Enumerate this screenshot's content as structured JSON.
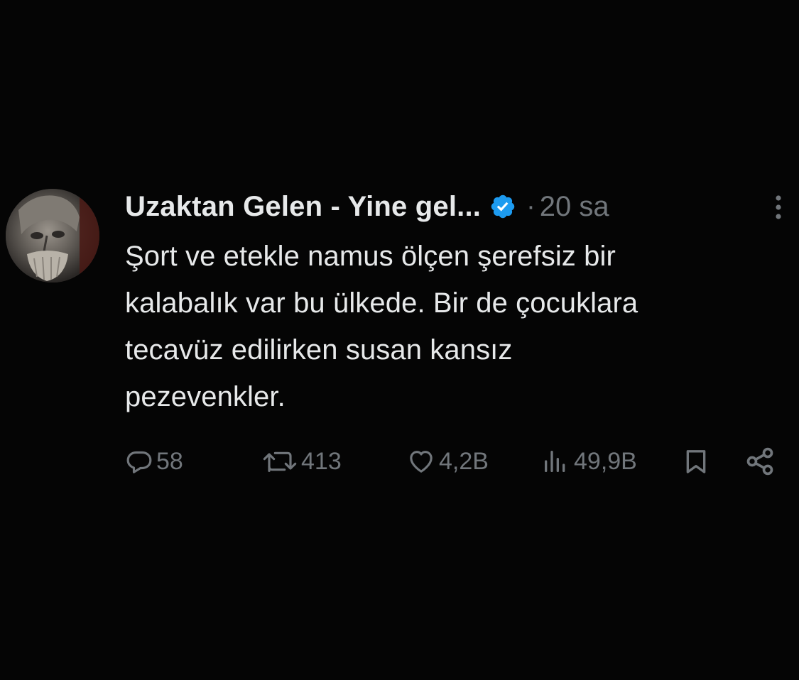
{
  "tweet": {
    "author_name": "Uzaktan Gelen - Yine gel...",
    "separator": "·",
    "time": "20 sa",
    "text": "Şort ve etekle namus ölçen şerefsiz bir\nkalabalık var bu ülkede. Bir de çocuklara\ntecavüz edilirken susan kansız\npezevenkler.",
    "icons": {
      "verified": "verified-badge-icon",
      "more": "more-vertical-icon"
    }
  },
  "actions": {
    "replies": "58",
    "retweets": "413",
    "likes": "4,2B",
    "views": "49,9B"
  },
  "colors": {
    "background": "#050505",
    "text": "#e7e9ea",
    "muted": "#71767b",
    "verified": "#1d9bf0"
  }
}
